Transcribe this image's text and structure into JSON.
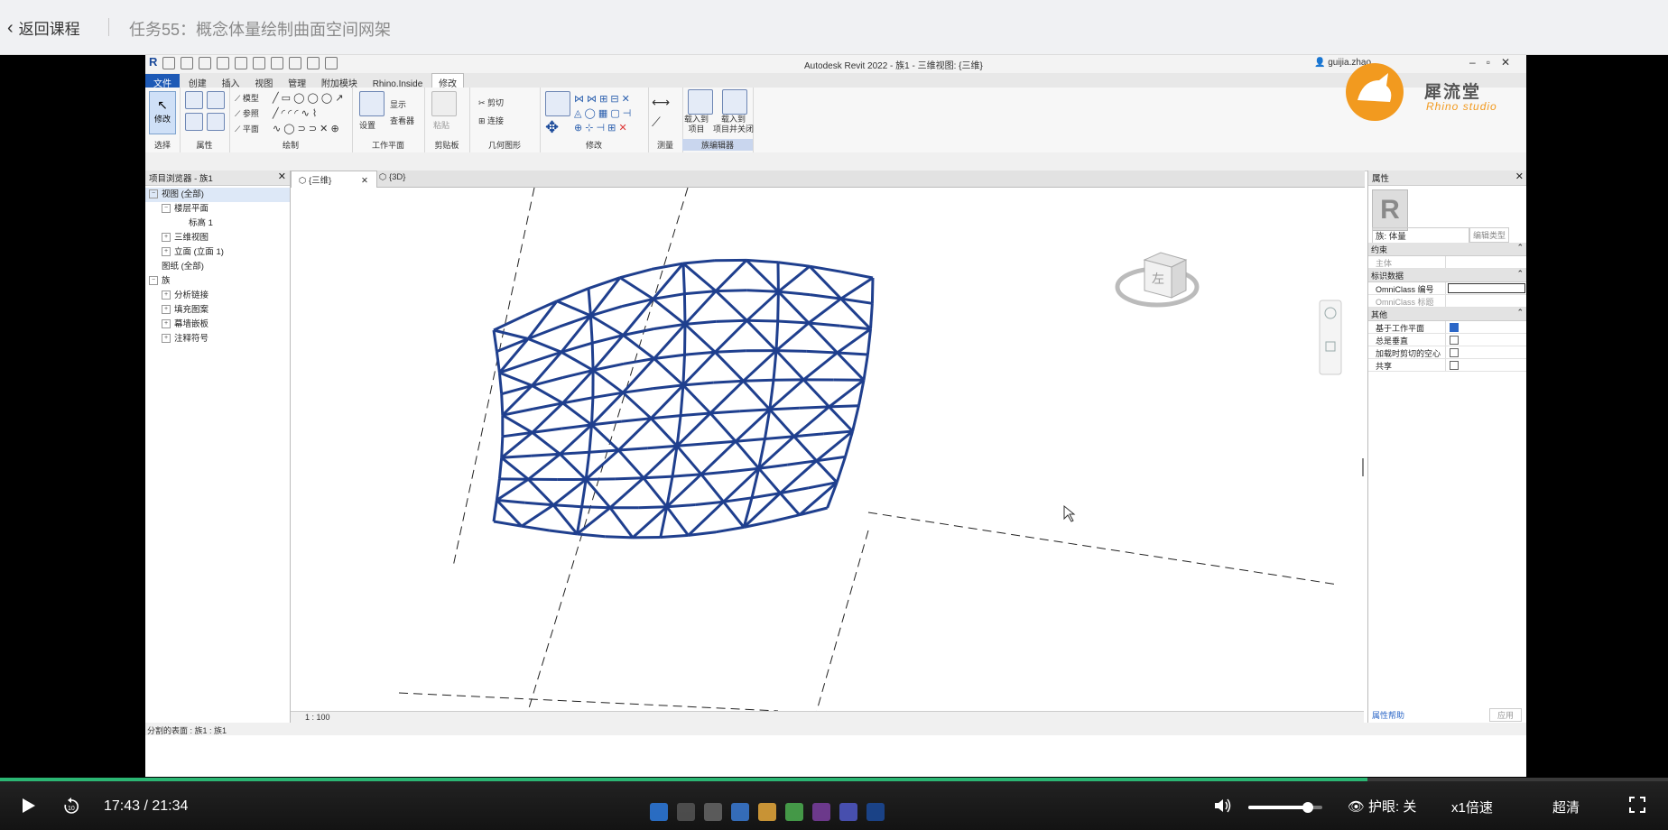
{
  "header": {
    "back_label": "返回课程",
    "course_title": "任务55：概念体量绘制曲面空间网架"
  },
  "revit": {
    "window_title": "Autodesk Revit 2022 - 族1 - 三维视图: {三维}",
    "user": "guijia.zhao",
    "ribbon_tabs": [
      "文件",
      "创建",
      "插入",
      "视图",
      "管理",
      "附加模块",
      "Rhino.Inside",
      "修改"
    ],
    "active_tab": "修改",
    "ribbon_groups": {
      "select": "选择",
      "properties": "属性",
      "draw": "绘制",
      "workplane": "工作平面",
      "clipboard": "剪贴板",
      "geometry": "几何图形",
      "modify": "修改",
      "measure": "测量",
      "family_editor": "族编辑器"
    },
    "ribbon_labels": {
      "modify_btn": "修改",
      "model": "模型",
      "reference": "参照",
      "plane": "平面",
      "set": "设置",
      "show": "显示",
      "viewer": "查看器",
      "paste": "粘贴",
      "cut": "剪切",
      "join": "连接",
      "load_into_project": "载入到\n项目",
      "load_into_project_close": "载入到\n项目并关闭"
    },
    "browser": {
      "title": "项目浏览器 - 族1",
      "items": [
        {
          "label": "视图 (全部)",
          "level": 0,
          "sign": "−"
        },
        {
          "label": "楼层平面",
          "level": 1,
          "sign": "−"
        },
        {
          "label": "标高 1",
          "level": 2,
          "sign": ""
        },
        {
          "label": "三维视图",
          "level": 1,
          "sign": "+"
        },
        {
          "label": "立面 (立面 1)",
          "level": 1,
          "sign": "+"
        },
        {
          "label": "图纸 (全部)",
          "level": 0,
          "sign": ""
        },
        {
          "label": "族",
          "level": 0,
          "sign": "−"
        },
        {
          "label": "分析链接",
          "level": 1,
          "sign": "+"
        },
        {
          "label": "填充图案",
          "level": 1,
          "sign": "+"
        },
        {
          "label": "幕墙嵌板",
          "level": 1,
          "sign": "+"
        },
        {
          "label": "注释符号",
          "level": 1,
          "sign": "+"
        }
      ]
    },
    "view_tabs": [
      "{三维}",
      "{3D}"
    ],
    "viewcube_face": "左",
    "scale": "1 : 100",
    "status_text": "分割的表面 : 族1 : 族1",
    "properties": {
      "title": "属性",
      "type": "族: 体量",
      "edit_type": "编辑类型",
      "groups": [
        {
          "name": "约束",
          "rows": [
            {
              "key": "主体",
              "value": "",
              "dim": true,
              "kind": "text"
            }
          ]
        },
        {
          "name": "标识数据",
          "rows": [
            {
              "key": "OmniClass 编号",
              "value": "",
              "dim": false,
              "kind": "input"
            },
            {
              "key": "OmniClass 标题",
              "value": "",
              "dim": true,
              "kind": "text"
            }
          ]
        },
        {
          "name": "其他",
          "rows": [
            {
              "key": "基于工作平面",
              "value": "checked",
              "dim": false,
              "kind": "checkbox"
            },
            {
              "key": "总是垂直",
              "value": "unchecked",
              "dim": false,
              "kind": "checkbox"
            },
            {
              "key": "加载时剪切的空心",
              "value": "unchecked",
              "dim": false,
              "kind": "checkbox"
            },
            {
              "key": "共享",
              "value": "unchecked",
              "dim": false,
              "kind": "checkbox"
            }
          ]
        }
      ],
      "help": "属性帮助",
      "apply": "应用"
    }
  },
  "brand": {
    "zh": "犀流堂",
    "en": "Rhino studio"
  },
  "player": {
    "time": "17:43 / 21:34",
    "progress": 0.82,
    "volume": 0.8,
    "eye_care": "护眼: 关",
    "speed": "x1倍速",
    "quality": "超清",
    "accent_color": "#2bb673"
  }
}
